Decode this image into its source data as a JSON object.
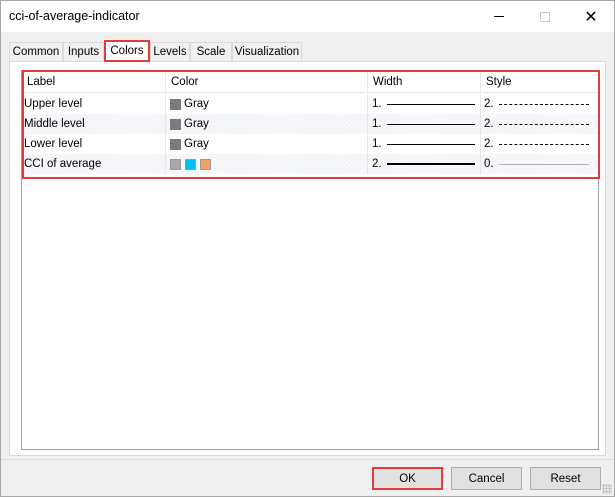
{
  "window": {
    "title": "cci-of-average-indicator",
    "close_glyph": "✕"
  },
  "tabs": [
    {
      "label": "Common"
    },
    {
      "label": "Inputs"
    },
    {
      "label": "Colors",
      "active": true
    },
    {
      "label": "Levels"
    },
    {
      "label": "Scale"
    },
    {
      "label": "Visualization"
    }
  ],
  "table": {
    "headers": {
      "label": "Label",
      "color": "Color",
      "width": "Width",
      "style": "Style"
    },
    "rows": [
      {
        "label": "Upper level",
        "color_name": "Gray",
        "color": "#808080",
        "width_num": "1.",
        "width_line": "thin",
        "style_num": "2.",
        "style_line": "dashed"
      },
      {
        "label": "Middle level",
        "color_name": "Gray",
        "color": "#808080",
        "width_num": "1.",
        "width_line": "thin",
        "style_num": "2.",
        "style_line": "dashed"
      },
      {
        "label": "Lower level",
        "color_name": "Gray",
        "color": "#808080",
        "width_num": "1.",
        "width_line": "thin",
        "style_num": "2.",
        "style_line": "dashed"
      },
      {
        "label": "CCI of average",
        "swatches": [
          "#a9a9a9",
          "#00bfff",
          "#f4a460"
        ],
        "width_num": "2.",
        "width_line": "thick",
        "style_num": "0.",
        "style_line": "solid-light"
      }
    ]
  },
  "buttons": {
    "ok": "OK",
    "cancel": "Cancel",
    "reset": "Reset"
  },
  "colors": {
    "highlight": "#e23b3b"
  }
}
